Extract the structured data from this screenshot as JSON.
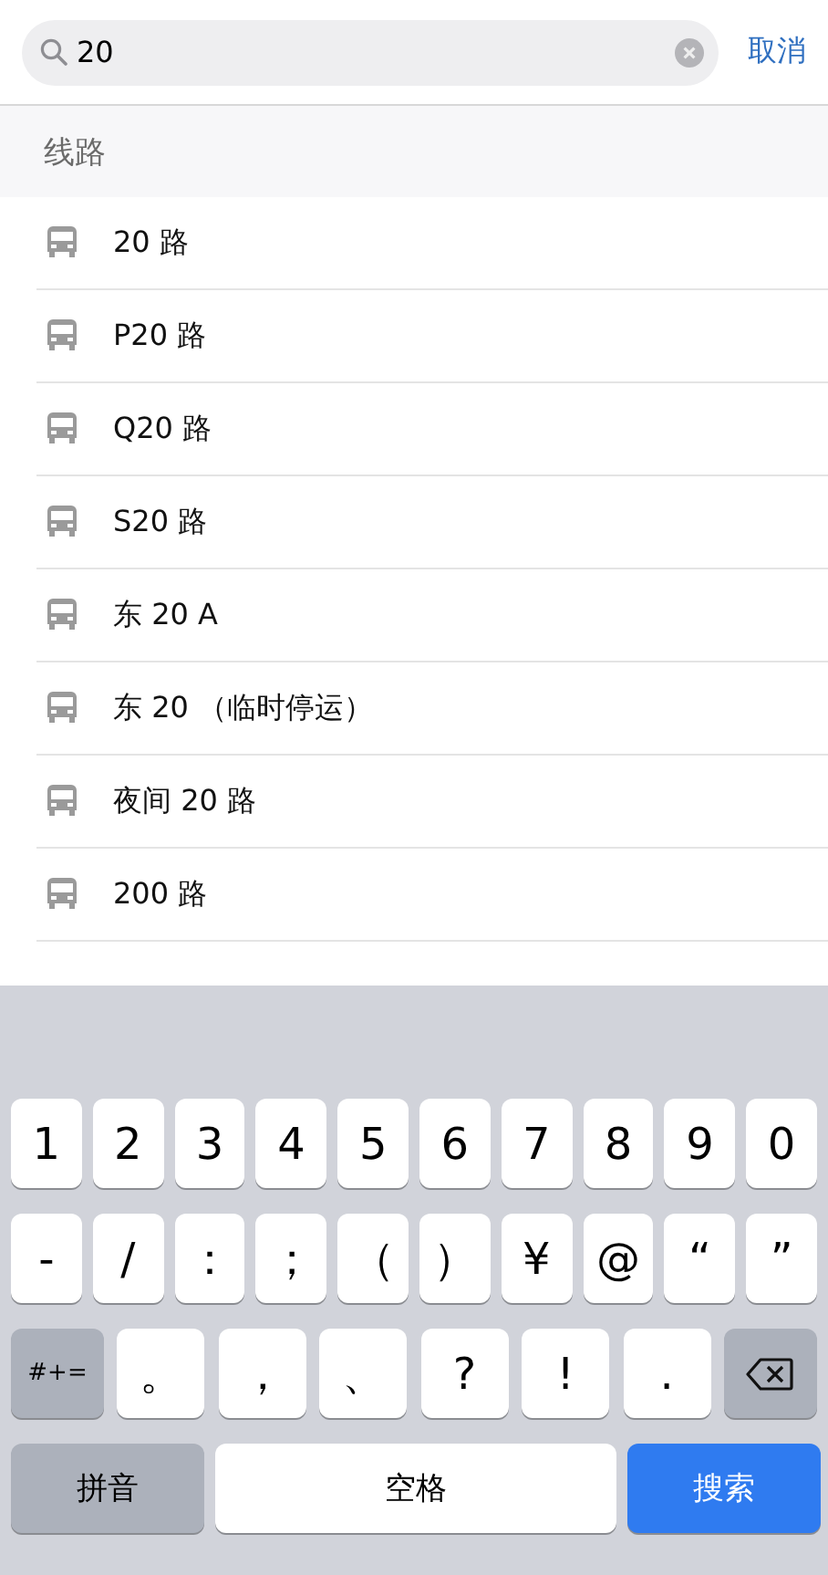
{
  "search": {
    "value": "20",
    "cancel": "取消"
  },
  "section": {
    "title": "线路"
  },
  "routes": [
    {
      "name": "20 路"
    },
    {
      "name": "P20 路"
    },
    {
      "name": "Q20 路"
    },
    {
      "name": "S20 路"
    },
    {
      "name": "东 20 A"
    },
    {
      "name": "东 20 （临时停运）"
    },
    {
      "name": "夜间 20 路"
    },
    {
      "name": "200 路"
    }
  ],
  "keyboard": {
    "rows": [
      {
        "keys": [
          {
            "kind": "char",
            "label": "1"
          },
          {
            "kind": "char",
            "label": "2"
          },
          {
            "kind": "char",
            "label": "3"
          },
          {
            "kind": "char",
            "label": "4"
          },
          {
            "kind": "char",
            "label": "5"
          },
          {
            "kind": "char",
            "label": "6"
          },
          {
            "kind": "char",
            "label": "7"
          },
          {
            "kind": "char",
            "label": "8"
          },
          {
            "kind": "char",
            "label": "9"
          },
          {
            "kind": "char",
            "label": "0"
          }
        ]
      },
      {
        "keys": [
          {
            "kind": "char",
            "label": "-"
          },
          {
            "kind": "char",
            "label": "/"
          },
          {
            "kind": "char",
            "label": "："
          },
          {
            "kind": "char",
            "label": "；"
          },
          {
            "kind": "char",
            "label": "（"
          },
          {
            "kind": "char",
            "label": "）"
          },
          {
            "kind": "char",
            "label": "¥"
          },
          {
            "kind": "char",
            "label": "@"
          },
          {
            "kind": "char",
            "label": "“"
          },
          {
            "kind": "char",
            "label": "”"
          }
        ]
      },
      {
        "keys": [
          {
            "kind": "function",
            "label": "#+="
          },
          {
            "kind": "char",
            "label": "。"
          },
          {
            "kind": "char",
            "label": "，"
          },
          {
            "kind": "char",
            "label": "、"
          },
          {
            "kind": "char",
            "label": "?"
          },
          {
            "kind": "char",
            "label": "!"
          },
          {
            "kind": "char",
            "label": "."
          },
          {
            "kind": "delete"
          }
        ]
      },
      {
        "keys": [
          {
            "kind": "function",
            "label": "拼音"
          },
          {
            "kind": "space",
            "label": "空格"
          },
          {
            "kind": "primary",
            "label": "搜索"
          }
        ]
      }
    ]
  }
}
